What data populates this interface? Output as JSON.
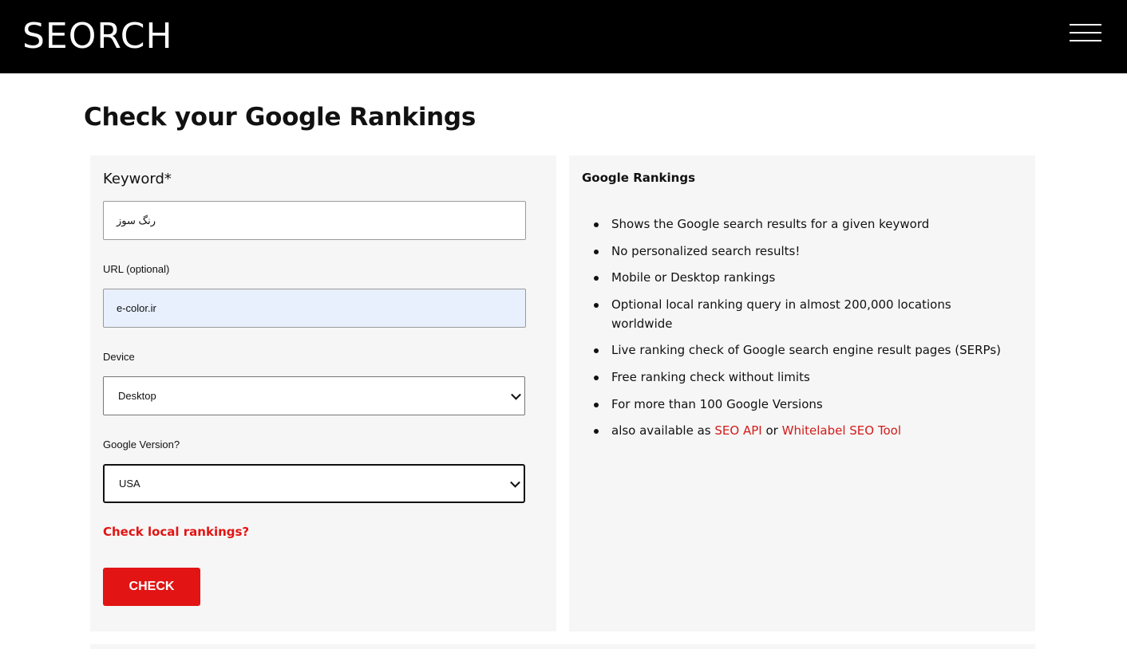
{
  "header": {
    "logo": "SEORCH",
    "menu_icon": "hamburger-menu-icon"
  },
  "page": {
    "title": "Check your Google Rankings"
  },
  "form": {
    "keyword_label": "Keyword*",
    "keyword_value": "رنگ سوز",
    "url_label": "URL (optional)",
    "url_value": "e-color.ir",
    "device_label": "Device",
    "device_value": "Desktop",
    "version_label": "Google Version?",
    "version_value": "USA",
    "local_link": "Check local rankings?",
    "check_button": "CHECK"
  },
  "info": {
    "title": "Google Rankings",
    "features": [
      "Shows the Google search results for a given keyword",
      "No personalized search results!",
      "Mobile or Desktop rankings",
      "Optional local ranking query in almost 200,000 locations worldwide",
      "Live ranking check of Google search engine result pages (SERPs)",
      "Free ranking check without limits",
      "For more than 100 Google Versions"
    ],
    "last_feature_prefix": "also available as",
    "seo_api_link": "SEO API",
    "connector": "or",
    "whitelabel_link": "Whitelabel SEO Tool"
  },
  "colors": {
    "accent": "#e21414",
    "header_bg": "#000000",
    "panel_bg": "#f6f6f6",
    "autofill_bg": "#e8f0fe"
  }
}
